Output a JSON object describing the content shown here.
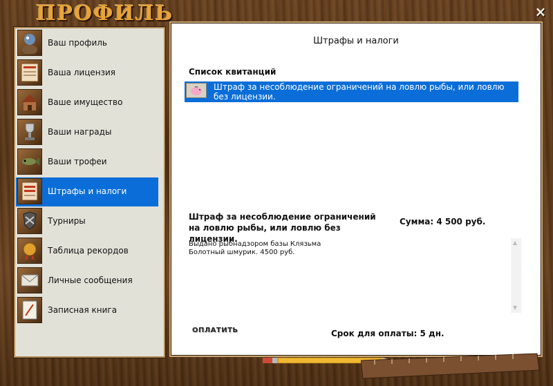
{
  "window": {
    "title": "ПРОФИЛЬ",
    "close_label": "×"
  },
  "sidebar": {
    "items": [
      {
        "label": "Ваш профиль",
        "icon": "profile-icon"
      },
      {
        "label": "Ваша лицензия",
        "icon": "license-icon"
      },
      {
        "label": "Ваше имущество",
        "icon": "property-icon"
      },
      {
        "label": "Ваши награды",
        "icon": "award-icon"
      },
      {
        "label": "Ваши трофеи",
        "icon": "trophy-fish-icon"
      },
      {
        "label": "Штрафы и налоги",
        "icon": "fine-document-icon",
        "active": true
      },
      {
        "label": "Турниры",
        "icon": "tournament-icon"
      },
      {
        "label": "Таблица рекордов",
        "icon": "records-icon"
      },
      {
        "label": "Личные сообщения",
        "icon": "envelope-icon"
      },
      {
        "label": "Записная книга",
        "icon": "notebook-icon"
      }
    ]
  },
  "content": {
    "title": "Штрафы и налоги",
    "list_heading": "Список квитанций",
    "receipts": [
      {
        "text": "Штраф за несоблюдение ограничений на ловлю рыбы, или ловлю без лицензии.",
        "icon": "piggy-bank-icon",
        "selected": true
      }
    ],
    "detail": {
      "title": "Штраф за несоблюдение ограничений на ловлю рыбы, или ловлю без лицензии.",
      "sum": "Сумма: 4 500 руб.",
      "description": "Выдано рыбнадзором базы Клязьма\nБолотный шмурик. 4500 руб."
    },
    "pay_button": "ОПЛАТИТЬ",
    "deadline": "Срок для оплаты: 5 дн."
  },
  "colors": {
    "accent": "#0b6ed8",
    "title": "#e8a43a",
    "wood": "#5a3819"
  }
}
